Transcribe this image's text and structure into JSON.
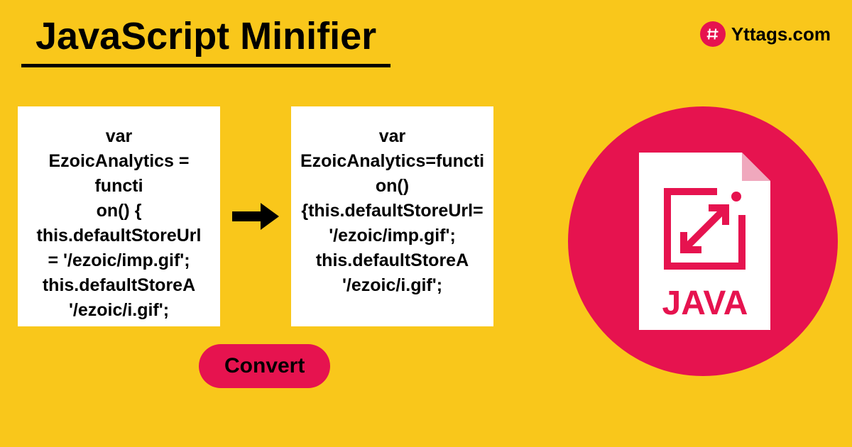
{
  "header": {
    "title": "JavaScript Minifier",
    "brand_name": "Yttags.com"
  },
  "input_code": {
    "line1": "var",
    "line2": "EzoicAnalytics = functi",
    "line3": "on() {",
    "line4": "this.defaultStoreUrl",
    "line5": " = '/ezoic/imp.gif';",
    "line6": "this.defaultStoreA",
    "line7": "'/ezoic/i.gif';"
  },
  "output_code": {
    "line1": "var",
    "line2": "EzoicAnalytics=functi",
    "line3": "on()",
    "line4": "{this.defaultStoreUrl=",
    "line5": "'/ezoic/imp.gif';",
    "line6": "this.defaultStoreA",
    "line7": "'/ezoic/i.gif';"
  },
  "button": {
    "convert_label": "Convert"
  },
  "badge": {
    "label": "JAVA"
  },
  "colors": {
    "background": "#f9c71b",
    "accent": "#e6134f",
    "text": "#000000",
    "box_bg": "#ffffff"
  }
}
